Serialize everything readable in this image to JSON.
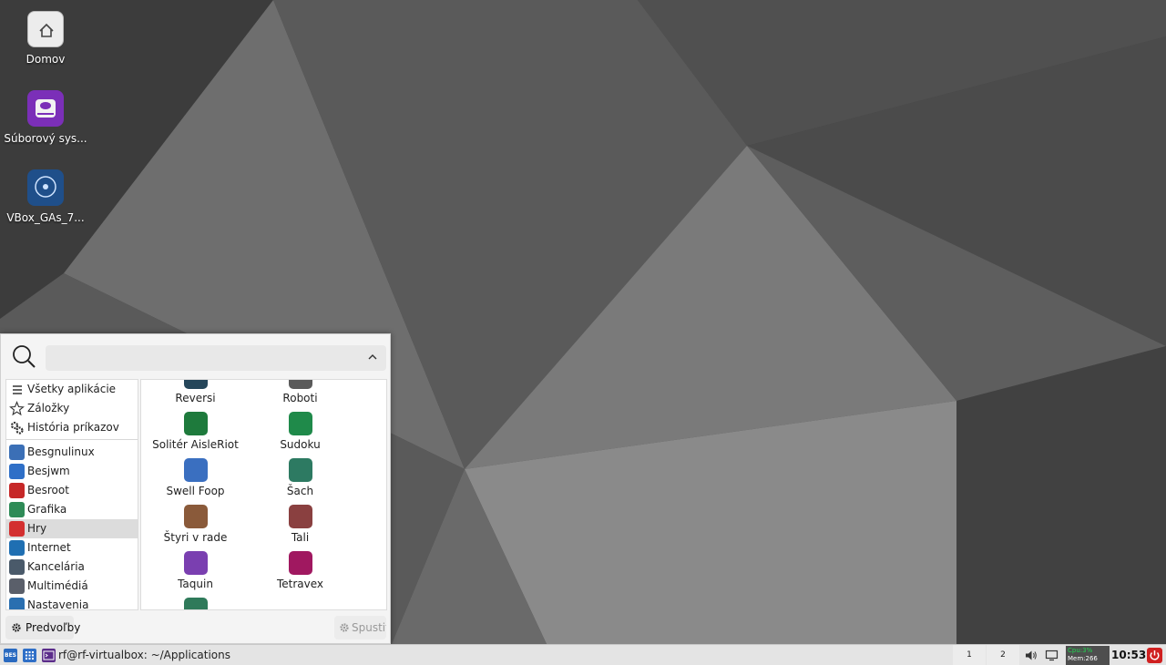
{
  "desktop": {
    "icons": [
      {
        "label": "Domov",
        "icon": "home-icon"
      },
      {
        "label": "Súborový sys...",
        "icon": "drive-icon"
      },
      {
        "label": "VBox_GAs_7...",
        "icon": "optical-disc-icon"
      }
    ]
  },
  "menu": {
    "search": {
      "value": "",
      "placeholder": ""
    },
    "fixed": [
      {
        "label": "Všetky aplikácie",
        "icon": "list-icon"
      },
      {
        "label": "Záložky",
        "icon": "star-icon"
      },
      {
        "label": "História príkazov",
        "icon": "gears-icon"
      }
    ],
    "categories": [
      {
        "label": "Besgnulinux",
        "color": "#3b6fb6"
      },
      {
        "label": "Besjwm",
        "color": "#2f6fc7"
      },
      {
        "label": "Besroot",
        "color": "#c62828"
      },
      {
        "label": "Grafika",
        "color": "#2e8b57"
      },
      {
        "label": "Hry",
        "color": "#d32f2f",
        "selected": true
      },
      {
        "label": "Internet",
        "color": "#1f6fb2"
      },
      {
        "label": "Kancelária",
        "color": "#4a5a6a"
      },
      {
        "label": "Multimédiá",
        "color": "#5a5f6a"
      },
      {
        "label": "Nastavenia",
        "color": "#2a6fb0"
      }
    ],
    "apps": [
      {
        "label": "Reversi",
        "color": "#25465a"
      },
      {
        "label": "Roboti",
        "color": "#5a5a5a"
      },
      {
        "label": "Solitér AisleRiot",
        "color": "#1e7a3c"
      },
      {
        "label": "Sudoku",
        "color": "#1f8a4a"
      },
      {
        "label": "Swell Foop",
        "color": "#3a6fc0"
      },
      {
        "label": "Šach",
        "color": "#2d7a62"
      },
      {
        "label": "Štyri v rade",
        "color": "#8a5a3a"
      },
      {
        "label": "Tali",
        "color": "#8a4040"
      },
      {
        "label": "Taquin",
        "color": "#7a3fb0"
      },
      {
        "label": "Tetravex",
        "color": "#a01860"
      },
      {
        "label": "",
        "color": "#2f7a5a"
      }
    ],
    "prefs_label": "Predvoľby",
    "run_label": "Spustiť"
  },
  "taskbar": {
    "launchers": [
      {
        "icon": "bes-menu-icon",
        "text": "BES"
      },
      {
        "icon": "app-grid-icon"
      },
      {
        "icon": "terminal-icon"
      }
    ],
    "task_title": "rf@rf-virtualbox: ~/Applications",
    "workspaces": [
      "1",
      "2"
    ],
    "sysmon": {
      "cpu": "Cpu:3%",
      "mem": "Mem:266"
    },
    "clock": "10:53"
  }
}
